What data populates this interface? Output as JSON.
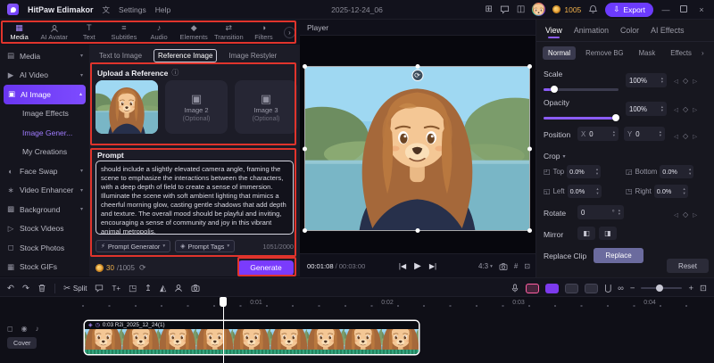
{
  "titlebar": {
    "app_name": "HitPaw Edimakor",
    "menu_language": "文",
    "menu_settings": "Settings",
    "menu_help": "Help",
    "project_name": "2025-12-24_06",
    "coin_count": "1005",
    "export_label": "Export"
  },
  "media_toolbar": {
    "items": [
      {
        "label": "Media"
      },
      {
        "label": "AI Avatar"
      },
      {
        "label": "Text"
      },
      {
        "label": "Subtitles"
      },
      {
        "label": "Audio"
      },
      {
        "label": "Elements"
      },
      {
        "label": "Transition"
      },
      {
        "label": "Filters"
      }
    ]
  },
  "sidebar": {
    "items": [
      {
        "label": "Media"
      },
      {
        "label": "AI Video"
      },
      {
        "label": "AI Image"
      },
      {
        "label": "Image Effects"
      },
      {
        "label": "Image Gener..."
      },
      {
        "label": "My Creations"
      },
      {
        "label": "Face Swap"
      },
      {
        "label": "Video Enhancer"
      },
      {
        "label": "Background"
      },
      {
        "label": "Stock Videos"
      },
      {
        "label": "Stock Photos"
      },
      {
        "label": "Stock GIFs"
      }
    ]
  },
  "ai_panel": {
    "tabs": [
      {
        "label": "Text to Image"
      },
      {
        "label": "Reference Image"
      },
      {
        "label": "Image Restyler"
      }
    ],
    "upload_title": "Upload a Reference",
    "slot2_label": "Image 2",
    "slot2_sub": "(Optional)",
    "slot3_label": "Image 3",
    "slot3_sub": "(Optional)",
    "prompt_title": "Prompt",
    "prompt_text": "should include a slightly elevated camera angle, framing the scene to emphasize the interactions between the characters, with a deep depth of field to create a sense of immersion. Illuminate the scene with soft ambient lighting that mimics a cheerful morning glow, casting gentle shadows that add depth and texture. The overall mood should be playful and inviting, encouraging a sense of community and joy in this vibrant animal metropolis.",
    "generator_label": "Prompt Generator",
    "tags_label": "Prompt Tags",
    "char_count": "1051/2000",
    "credits_current": "30",
    "credits_total": "/1005",
    "generate_label": "Generate"
  },
  "player": {
    "title": "Player",
    "time_current": "00:01:08",
    "time_total": "/ 00:03:00",
    "ratio": "4:3"
  },
  "props": {
    "tabs": [
      {
        "label": "View"
      },
      {
        "label": "Animation"
      },
      {
        "label": "Color"
      },
      {
        "label": "AI Effects"
      }
    ],
    "subtabs": [
      {
        "label": "Normal"
      },
      {
        "label": "Remove BG"
      },
      {
        "label": "Mask"
      },
      {
        "label": "Effects"
      }
    ],
    "scale_label": "Scale",
    "scale_value": "100%",
    "opacity_label": "Opacity",
    "opacity_value": "100%",
    "position_label": "Position",
    "pos_x_label": "X",
    "pos_x": "0",
    "pos_y_label": "Y",
    "pos_y": "0",
    "crop_label": "Crop",
    "crop_top_label": "Top",
    "crop_top": "0.0%",
    "crop_bottom_label": "Bottom",
    "crop_bottom": "0.0%",
    "crop_left_label": "Left",
    "crop_left": "0.0%",
    "crop_right_label": "Right",
    "crop_right": "0.0%",
    "rotate_label": "Rotate",
    "rotate_value": "0",
    "rotate_unit": "°",
    "mirror_label": "Mirror",
    "replace_clip_label": "Replace Clip",
    "replace_button": "Replace",
    "reset_label": "Reset"
  },
  "timeline": {
    "split_label": "Split",
    "ruler": [
      "0:01",
      "0:02",
      "0:03",
      "0:04"
    ],
    "cover_label": "Cover",
    "clip_label": "0:03 R2i_2025_12_24(1)"
  },
  "colors": {
    "accent_purple": "#6C3BFF",
    "annotation_red": "#e0342c",
    "coin_gold": "#f0a43e",
    "toggle_pink": "#ff5fa2",
    "clip_audio_green": "#35a37d"
  },
  "icons": {
    "apps": "⊞",
    "monitor": "◫",
    "export_arrow": "⇩",
    "minimize": "—",
    "close": "×",
    "media": "▦",
    "text": "T",
    "subtitles": "≡",
    "audio": "♪",
    "elements": "◆",
    "transition": "⇄",
    "filters": "◑",
    "chevron_right": "›",
    "chevron_down": "▾",
    "chevron_up": "▴",
    "folder": "▤",
    "ai_video": "▶",
    "ai_image": "▣",
    "face_swap": "◐",
    "enhancer": "∗",
    "background": "▩",
    "stock_videos": "▷",
    "stock_photos": "◻",
    "stock_gifs": "▦",
    "info": "ⓘ",
    "image_placeholder": "▣",
    "prompt_generator": "⚡",
    "prompt_tags": "◈",
    "refresh": "⟳",
    "undo": "↶",
    "redo": "↷",
    "scissors": "✂",
    "add_text": "T+",
    "crop": "◳",
    "export_frame": "↥",
    "mirror": "◭",
    "magnet": "⋃",
    "link": "∞",
    "minus": "−",
    "plus": "+",
    "fit": "⊡",
    "grid": "#",
    "rotate": "⟳",
    "prev_frame": "|◀",
    "play": "▶",
    "next_frame": "▶|",
    "kf_left": "◁",
    "kf_diamond": "◇",
    "kf_right": "▷",
    "corner_tl": "◰",
    "corner_tr": "◳",
    "corner_bl": "◱",
    "corner_br": "◲",
    "flip_h": "◧",
    "flip_v": "◨",
    "lock": "◻",
    "eye": "◉",
    "note": "♪",
    "badge": "◈",
    "clock": "◷"
  }
}
